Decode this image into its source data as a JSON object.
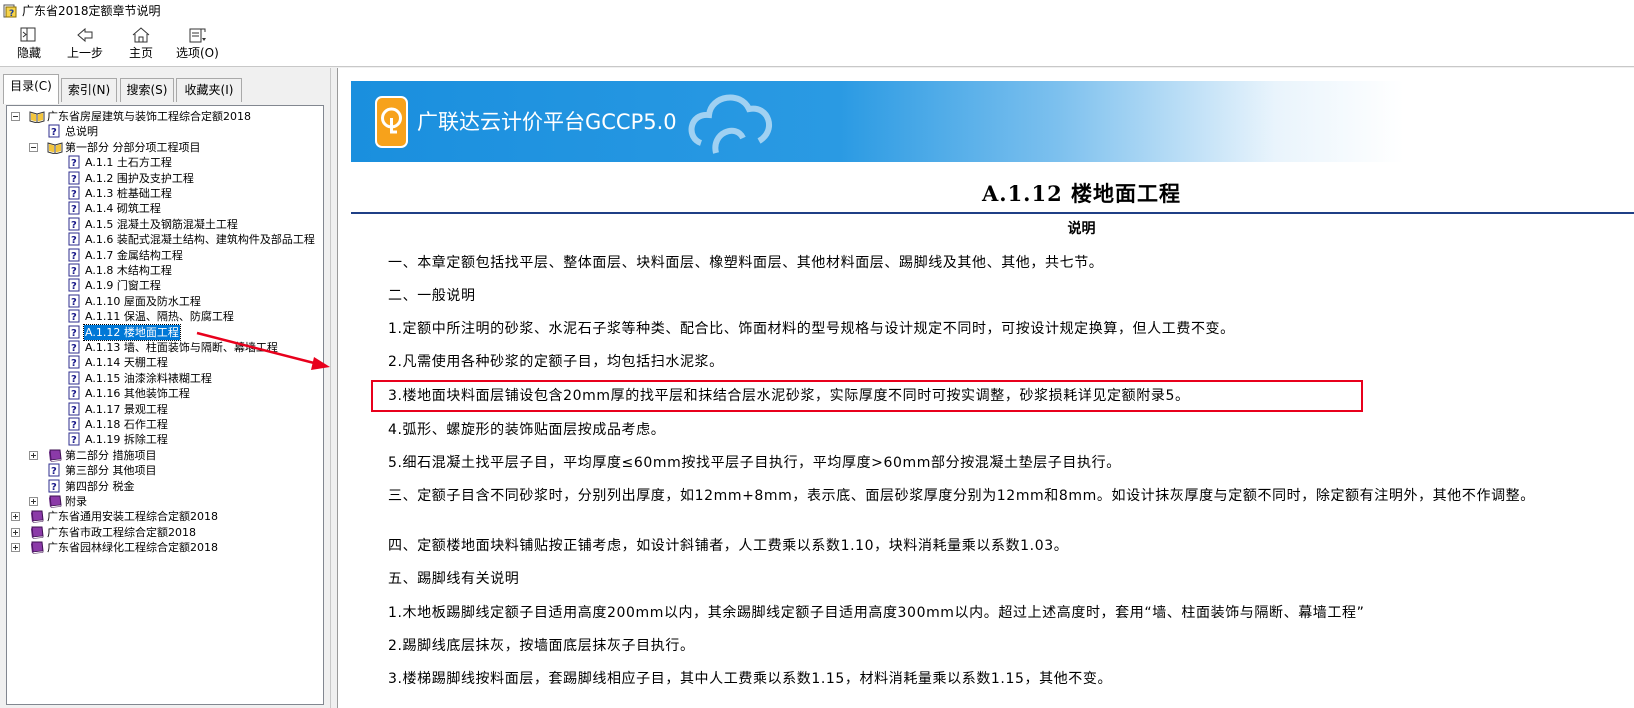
{
  "window": {
    "title": "广东省2018定额章节说明"
  },
  "toolbar": {
    "hide": "隐藏",
    "back": "上一步",
    "home": "主页",
    "options": "选项(O)"
  },
  "tabs": [
    "目录(C)",
    "索引(N)",
    "搜索(S)",
    "收藏夹(I)"
  ],
  "tree": [
    {
      "label": "广东省房屋建筑与装饰工程综合定额2018",
      "icon": "book-open-icon",
      "expander": "minus"
    },
    {
      "label": "总说明",
      "icon": "help-page-icon"
    },
    {
      "label": "第一部分 分部分项工程项目",
      "icon": "book-open-icon",
      "expander": "minus"
    },
    {
      "label": "A.1.1 土石方工程",
      "icon": "help-page-icon"
    },
    {
      "label": "A.1.2 围护及支护工程",
      "icon": "help-page-icon"
    },
    {
      "label": "A.1.3 桩基础工程",
      "icon": "help-page-icon"
    },
    {
      "label": "A.1.4 砌筑工程",
      "icon": "help-page-icon"
    },
    {
      "label": "A.1.5 混凝土及钢筋混凝土工程",
      "icon": "help-page-icon"
    },
    {
      "label": "A.1.6 装配式混凝土结构、建筑构件及部品工程",
      "icon": "help-page-icon"
    },
    {
      "label": "A.1.7 金属结构工程",
      "icon": "help-page-icon"
    },
    {
      "label": "A.1.8 木结构工程",
      "icon": "help-page-icon"
    },
    {
      "label": "A.1.9 门窗工程",
      "icon": "help-page-icon"
    },
    {
      "label": "A.1.10 屋面及防水工程",
      "icon": "help-page-icon"
    },
    {
      "label": "A.1.11 保温、隔热、防腐工程",
      "icon": "help-page-icon"
    },
    {
      "label": "A.1.12 楼地面工程",
      "icon": "help-page-icon",
      "selected": true
    },
    {
      "label": "A.1.13 墙、柱面装饰与隔断、幕墙工程",
      "icon": "help-page-icon"
    },
    {
      "label": "A.1.14 天棚工程",
      "icon": "help-page-icon"
    },
    {
      "label": "A.1.15 油漆涂料裱糊工程",
      "icon": "help-page-icon"
    },
    {
      "label": "A.1.16 其他装饰工程",
      "icon": "help-page-icon"
    },
    {
      "label": "A.1.17 景观工程",
      "icon": "help-page-icon"
    },
    {
      "label": "A.1.18 石作工程",
      "icon": "help-page-icon"
    },
    {
      "label": "A.1.19 拆除工程",
      "icon": "help-page-icon"
    },
    {
      "label": "第二部分 措施项目",
      "icon": "book-closed-icon",
      "expander": "plus"
    },
    {
      "label": "第三部分 其他项目",
      "icon": "help-page-icon"
    },
    {
      "label": "第四部分 税金",
      "icon": "help-page-icon"
    },
    {
      "label": "附录",
      "icon": "book-closed-icon",
      "expander": "plus"
    },
    {
      "label": "广东省通用安装工程综合定额2018",
      "icon": "book-closed-icon",
      "expander": "plus"
    },
    {
      "label": "广东省市政工程综合定额2018",
      "icon": "book-closed-icon",
      "expander": "plus"
    },
    {
      "label": "广东省园林绿化工程综合定额2018",
      "icon": "book-closed-icon",
      "expander": "plus"
    }
  ],
  "banner": {
    "title": "广联达云计价平台GCCP5.0"
  },
  "document": {
    "heading": "A.1.12 楼地面工程",
    "subheading": "说明",
    "paragraphs": [
      "一、本章定额包括找平层、整体面层、块料面层、橡塑料面层、其他材料面层、踢脚线及其他、其他，共七节。",
      "二、一般说明",
      "1.定额中所注明的砂浆、水泥石子浆等种类、配合比、饰面材料的型号规格与设计规定不同时，可按设计规定换算，但人工费不变。",
      "2.凡需使用各种砂浆的定额子目，均包括扫水泥浆。",
      "3.楼地面块料面层铺设包含20mm厚的找平层和抹结合层水泥砂浆，实际厚度不同时可按实调整，砂浆损耗详见定额附录5。",
      "4.弧形、螺旋形的装饰贴面层按成品考虑。",
      "5.细石混凝土找平层子目，平均厚度≤60mm按找平层子目执行，平均厚度>60mm部分按混凝土垫层子目执行。",
      "三、定额子目含不同砂浆时，分别列出厚度，如12mm+8mm，表示底、面层砂浆厚度分别为12mm和8mm。如设计抹灰厚度与定额不同时，除定额有注明外，其他不作调整。",
      "四、定额楼地面块料铺贴按正铺考虑，如设计斜铺者，人工费乘以系数1.10，块料消耗量乘以系数1.03。",
      "五、踢脚线有关说明",
      "1.木地板踢脚线定额子目适用高度200mm以内，其余踢脚线定额子目适用高度300mm以内。超过上述高度时，套用“墙、柱面装饰与隔断、幕墙工程”",
      "2.踢脚线底层抹灰，按墙面底层抹灰子目执行。",
      "3.楼梯踢脚线按料面层，套踢脚线相应子目，其中人工费乘以系数1.15，材料消耗量乘以系数1.15，其他不变。"
    ]
  },
  "colors": {
    "selection": "#0078d7",
    "highlight_box": "#e8001c",
    "arrow": "#e8001c",
    "banner_blue": "#1a8fde"
  }
}
